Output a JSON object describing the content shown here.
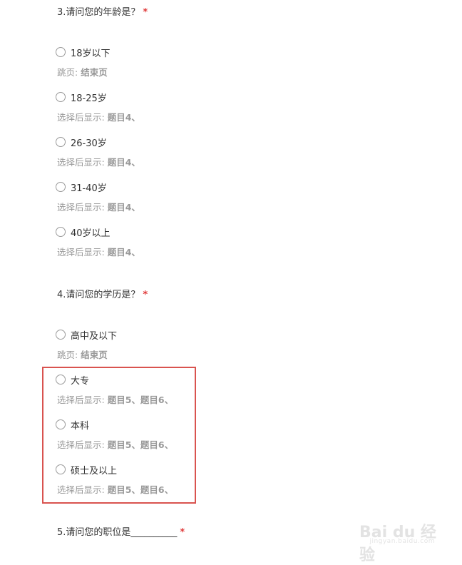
{
  "q3": {
    "title": "3.请问您的年龄是？",
    "required_mark": "*",
    "options": [
      {
        "label": "18岁以下",
        "note_prefix": "跳页:",
        "note_value": "结束页"
      },
      {
        "label": "18-25岁",
        "note_prefix": "选择后显示:",
        "note_value": "题目4、"
      },
      {
        "label": "26-30岁",
        "note_prefix": "选择后显示:",
        "note_value": "题目4、"
      },
      {
        "label": "31-40岁",
        "note_prefix": "选择后显示:",
        "note_value": "题目4、"
      },
      {
        "label": "40岁以上",
        "note_prefix": "选择后显示:",
        "note_value": "题目4、"
      }
    ]
  },
  "q4": {
    "title": "4.请问您的学历是？",
    "required_mark": "*",
    "options": [
      {
        "label": "高中及以下",
        "note_prefix": "跳页:",
        "note_value": "结束页"
      },
      {
        "label": "大专",
        "note_prefix": "选择后显示:",
        "note_value": "题目5、题目6、"
      },
      {
        "label": "本科",
        "note_prefix": "选择后显示:",
        "note_value": "题目5、题目6、"
      },
      {
        "label": "硕士及以上",
        "note_prefix": "选择后显示:",
        "note_value": "题目5、题目6、"
      }
    ]
  },
  "q5": {
    "title": "5.请问您的职位是__________",
    "required_mark": "*"
  },
  "watermark": {
    "main": "Bai du 经验",
    "sub": "jingyan.baidu.com"
  },
  "colors": {
    "required": "#e03a3a",
    "highlight_border": "#d9534f",
    "note_text": "#999999"
  }
}
